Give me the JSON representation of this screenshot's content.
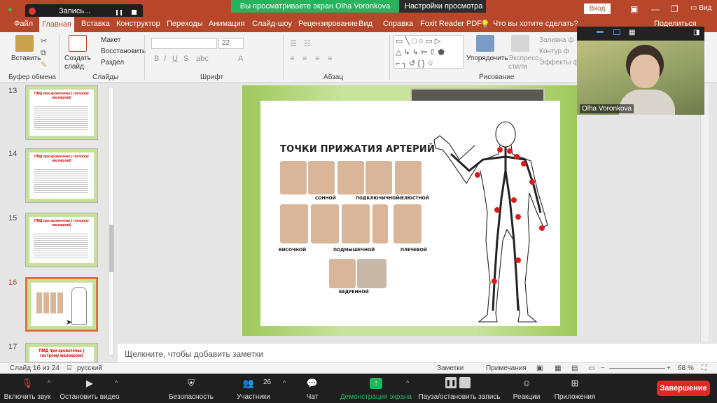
{
  "window": {
    "recording_label": "Запись...",
    "share_banner": "Вы просматриваете экран Olha Voronkova",
    "view_settings": "Настройки просмотра",
    "signin": "Вход",
    "view_partial": "Вид"
  },
  "ribbon_tabs": [
    "Файл",
    "Главная",
    "Вставка",
    "Конструктор",
    "Переходы",
    "Анимация",
    "Слайд-шоу",
    "Рецензирование",
    "Вид",
    "Справка",
    "Foxit Reader PDF"
  ],
  "tell_me": "Что вы хотите сделать?",
  "share_label": "Поделиться",
  "ribbon": {
    "paste": "Вставить",
    "clipboard_group": "Буфер обмена",
    "new_slide": "Создать слайд",
    "layout": "Макет",
    "reset": "Восстановить",
    "section": "Раздел",
    "slides_group": "Слайды",
    "font_size": "22",
    "font_group": "Шрифт",
    "paragraph_group": "Абзац",
    "arrange": "Упорядочить",
    "quick_styles": "Экспресс-стили",
    "drawing_group": "Рисование",
    "shape_fill": "Заливка ф",
    "shape_outline": "Контур ф",
    "shape_effects": "Эффекты ф"
  },
  "thumbnails": [
    {
      "num": "13",
      "title": "ПМД при кровотечах ( гостропу малокрові)"
    },
    {
      "num": "14",
      "title": "ПМД при кровотечах ( гостропу малокрові)"
    },
    {
      "num": "15",
      "title": "ПМД при кровотечах ( гостропу малокрові)"
    },
    {
      "num": "16",
      "title": ""
    },
    {
      "num": "17",
      "title": "ПМД при кровотечах ( гострому малокрові)"
    }
  ],
  "slide": {
    "title": "ТОЧКИ ПРИЖАТИЯ АРТЕРИЙ",
    "captions": [
      "СОННОЙ",
      "ПОДКЛЮЧИЧНОЙ",
      "ЧЕЛЮСТНОЙ",
      "ВИСОЧНОЙ",
      "ПОДМЫШЕЧНОЙ",
      "ПЛЕЧЕВОЙ",
      "БЕДРЕННОЙ"
    ]
  },
  "notes_placeholder": "Щелкните, чтобы добавить заметки",
  "status": {
    "slide_info": "Слайд 16 из 24",
    "language": "русский",
    "notes": "Заметки",
    "comments": "Примечания",
    "zoom": "68 %"
  },
  "video": {
    "participant": "Olha Voronkova"
  },
  "zoom_toolbar": {
    "mute": "Включить звук",
    "video": "Остановить видео",
    "security": "Безопасность",
    "participants": "Участники",
    "participants_count": "26",
    "chat": "Чат",
    "share": "Демонстрация экрана",
    "pause_recording": "Пауза/остановить запись",
    "reactions": "Реакции",
    "apps": "Приложения",
    "end": "Завершение"
  },
  "colors": {
    "accent": "#b7472a",
    "share_green": "#27b35b",
    "end_red": "#e02828",
    "slide_green": "#9fc85a",
    "artery_red": "#d91c1c"
  }
}
